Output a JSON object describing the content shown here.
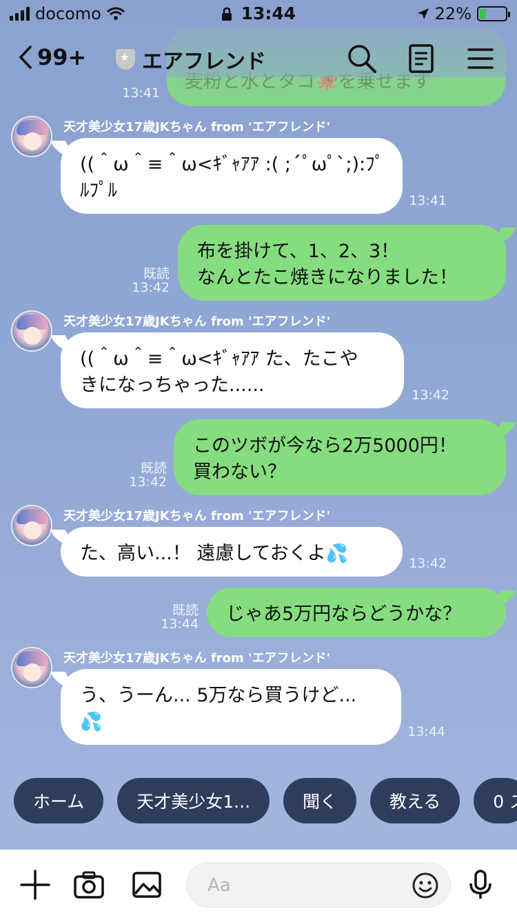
{
  "status_bar": {
    "carrier": "docomo",
    "time": "13:44",
    "battery": "22%"
  },
  "header": {
    "back_count": "99+",
    "title": "エアフレンド"
  },
  "partial_message": {
    "text": "麦粉と水とタコ🐙を乗せます",
    "time": "13:41"
  },
  "messages": [
    {
      "sender": "天才美少女17歳JKちゃん from 'エアフレンド'",
      "line1": "((＾ω＾≡＾ω<ｷﾞｬｱｱ :( ;´ﾟωﾟ`;):ﾌﾟ",
      "line2": "ﾙﾌﾟﾙ",
      "time": "13:41"
    },
    {
      "line1": "布を掛けて、1、2、3！",
      "line2": "なんとたこ焼きになりました！",
      "read": "既読",
      "time": "13:42"
    },
    {
      "sender": "天才美少女17歳JKちゃん from 'エアフレンド'",
      "line1": "((＾ω＾≡＾ω<ｷﾞｬｱｱ た、たこや",
      "line2": "きになっちゃった......",
      "time": "13:42"
    },
    {
      "line1": "このツボが今なら2万5000円！",
      "line2": "買わない？",
      "read": "既読",
      "time": "13:42"
    },
    {
      "sender": "天才美少女17歳JKちゃん from 'エアフレンド'",
      "line1": "た、高い...！ 遠慮しておくよ",
      "time": "13:42"
    },
    {
      "line1": "じゃあ5万円ならどうかな？",
      "read": "既読",
      "time": "13:44"
    },
    {
      "sender": "天才美少女17歳JKちゃん from 'エアフレンド'",
      "line1": "う、うーん... 5万なら買うけど...",
      "time": "13:44"
    }
  ],
  "quick_replies": [
    "ホーム",
    "天才美少女1...",
    "聞く",
    "教える",
    "0 ス"
  ],
  "input": {
    "placeholder": "Aa"
  },
  "icons": {
    "drops": "💦"
  },
  "colors": {
    "background": "#8ea4d2",
    "outgoing_bubble": "#86dd7f",
    "incoming_bubble": "#ffffff",
    "quick_reply": "#2f3d5c",
    "battery_fill": "#3cc04b"
  }
}
